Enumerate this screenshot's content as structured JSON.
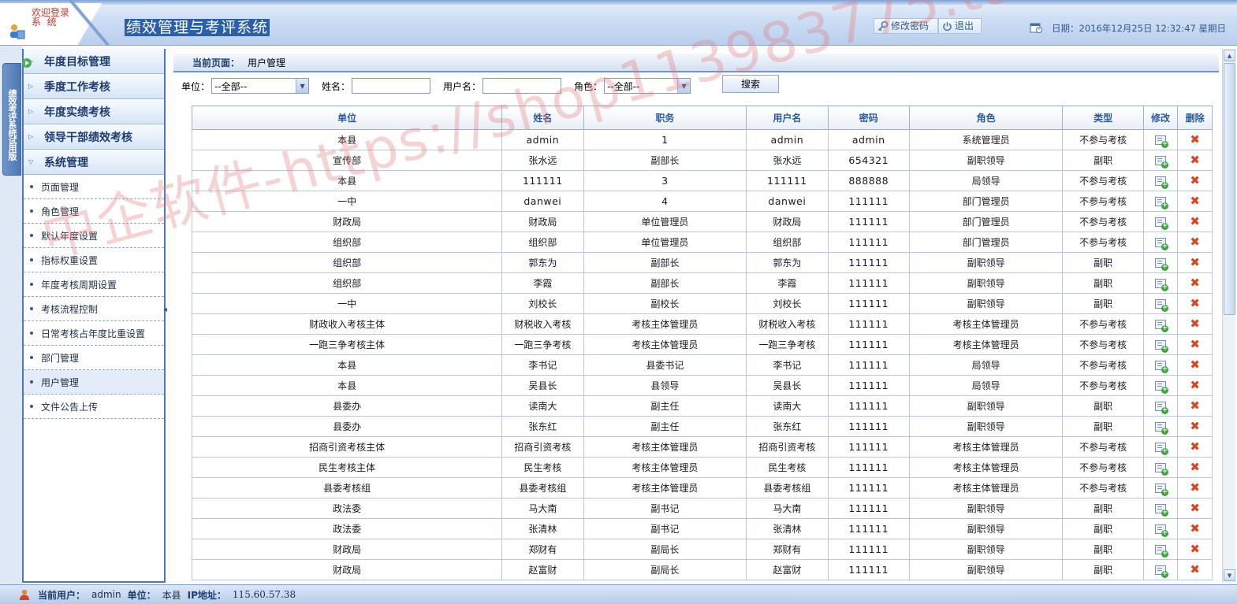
{
  "header": {
    "welcome_line1": "欢迎登录",
    "welcome_line2": "系  统",
    "system_title": "绩效管理与考评系统",
    "change_password_label": "修改密码",
    "logout_label": "退出",
    "date_text": "日期：2016年12月25日  12:32:47 星期日"
  },
  "vertical_tab": "绩效考评系统试用版",
  "sidebar": {
    "groups": [
      {
        "label": "年度目标管理",
        "arrow": "▷"
      },
      {
        "label": "季度工作考核",
        "arrow": "▷"
      },
      {
        "label": "年度实绩考核",
        "arrow": "▷"
      },
      {
        "label": "领导干部绩效考核",
        "arrow": "▷"
      },
      {
        "label": "系统管理",
        "arrow": "▽"
      }
    ],
    "items": [
      {
        "label": "页面管理"
      },
      {
        "label": "角色管理"
      },
      {
        "label": "默认年度设置"
      },
      {
        "label": "指标权重设置"
      },
      {
        "label": "年度考核周期设置"
      },
      {
        "label": "考核流程控制"
      },
      {
        "label": "日常考核占年度比重设置"
      },
      {
        "label": "部门管理"
      },
      {
        "label": "用户管理"
      },
      {
        "label": "文件公告上传"
      }
    ]
  },
  "content": {
    "current_page_label": "当前页面：",
    "current_page_value": "用户管理"
  },
  "filters": {
    "unit_label": "单位：",
    "unit_value": "--全部--",
    "name_label": "姓名：",
    "name_value": "",
    "username_label": "用户名：",
    "username_value": "",
    "role_label": "角色：",
    "role_value": "--全部--",
    "search_label": "搜索"
  },
  "table": {
    "headers": [
      "单位",
      "姓名",
      "职务",
      "用户名",
      "密码",
      "角色",
      "类型",
      "修改",
      "删除"
    ],
    "rows": [
      [
        "本县",
        "admin",
        "1",
        "admin",
        "admin",
        "系统管理员",
        "不参与考核"
      ],
      [
        "宣传部",
        "张水远",
        "副部长",
        "张水远",
        "654321",
        "副职领导",
        "副职"
      ],
      [
        "本县",
        "111111",
        "3",
        "111111",
        "888888",
        "局领导",
        "不参与考核"
      ],
      [
        "一中",
        "danwei",
        "4",
        "danwei",
        "111111",
        "部门管理员",
        "不参与考核"
      ],
      [
        "财政局",
        "财政局",
        "单位管理员",
        "财政局",
        "111111",
        "部门管理员",
        "不参与考核"
      ],
      [
        "组织部",
        "组织部",
        "单位管理员",
        "组织部",
        "111111",
        "部门管理员",
        "不参与考核"
      ],
      [
        "组织部",
        "郭东为",
        "副部长",
        "郭东为",
        "111111",
        "副职领导",
        "副职"
      ],
      [
        "组织部",
        "李霞",
        "副部长",
        "李霞",
        "111111",
        "副职领导",
        "副职"
      ],
      [
        "一中",
        "刘校长",
        "副校长",
        "刘校长",
        "111111",
        "副职领导",
        "副职"
      ],
      [
        "财政收入考核主体",
        "财税收入考核",
        "考核主体管理员",
        "财税收入考核",
        "111111",
        "考核主体管理员",
        "不参与考核"
      ],
      [
        "一跑三争考核主体",
        "一跑三争考核",
        "考核主体管理员",
        "一跑三争考核",
        "111111",
        "考核主体管理员",
        "不参与考核"
      ],
      [
        "本县",
        "李书记",
        "县委书记",
        "李书记",
        "111111",
        "局领导",
        "不参与考核"
      ],
      [
        "本县",
        "吴县长",
        "县领导",
        "吴县长",
        "111111",
        "局领导",
        "不参与考核"
      ],
      [
        "县委办",
        "读南大",
        "副主任",
        "读南大",
        "111111",
        "副职领导",
        "副职"
      ],
      [
        "县委办",
        "张东红",
        "副主任",
        "张东红",
        "111111",
        "副职领导",
        "副职"
      ],
      [
        "招商引资考核主体",
        "招商引资考核",
        "考核主体管理员",
        "招商引资考核",
        "111111",
        "考核主体管理员",
        "不参与考核"
      ],
      [
        "民生考核主体",
        "民生考核",
        "考核主体管理员",
        "民生考核",
        "111111",
        "考核主体管理员",
        "不参与考核"
      ],
      [
        "县委考核组",
        "县委考核组",
        "考核主体管理员",
        "县委考核组",
        "111111",
        "考核主体管理员",
        "不参与考核"
      ],
      [
        "政法委",
        "马大南",
        "副书记",
        "马大南",
        "111111",
        "副职领导",
        "副职"
      ],
      [
        "政法委",
        "张清林",
        "副书记",
        "张清林",
        "111111",
        "副职领导",
        "副职"
      ],
      [
        "财政局",
        "郑财有",
        "副局长",
        "郑财有",
        "111111",
        "副职领导",
        "副职"
      ],
      [
        "财政局",
        "赵富财",
        "副局长",
        "赵富财",
        "111111",
        "副职领导",
        "副职"
      ]
    ]
  },
  "watermark": "中企软件-https://shop113983775.taobao.com",
  "footer": {
    "current_user_label": "当前用户：",
    "current_user_value": "admin",
    "unit_label": "单位：",
    "unit_value": "本县",
    "ip_label": "IP地址：",
    "ip_value": "115.60.57.38"
  },
  "colors": {
    "accent": "#2b5fa8",
    "header_text": "#2a5b9a",
    "delete": "#e0441a",
    "edit_plus": "#3aa63a"
  },
  "icons": {
    "edit": "edit-icon",
    "delete": "delete-icon",
    "user": "user-icon",
    "calendar": "calendar-icon",
    "key": "key-icon",
    "power": "power-icon"
  }
}
